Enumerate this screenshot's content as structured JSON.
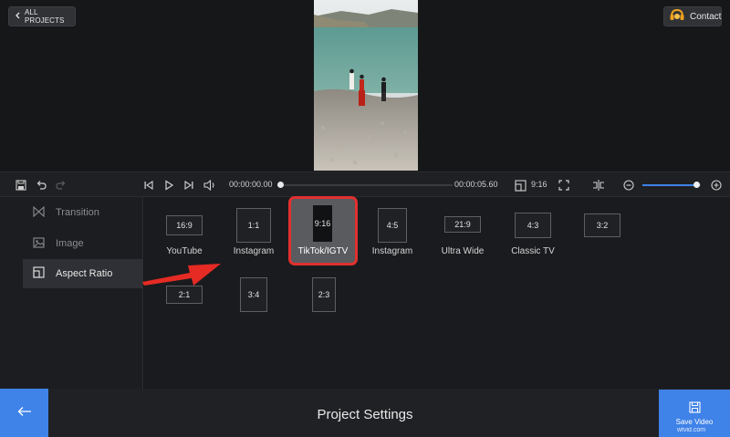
{
  "header": {
    "all_projects_label": "ALL PROJECTS",
    "contact_label": "Contact"
  },
  "toolbar": {
    "time_current": "00:00:00.00",
    "time_total": "00:00:05.60",
    "ratio_label": "9:16",
    "progress": 0.0,
    "zoom": 0.92
  },
  "sidebar": {
    "items": [
      {
        "label": "Transition",
        "icon": "transition-icon"
      },
      {
        "label": "Image",
        "icon": "image-icon"
      },
      {
        "label": "Aspect Ratio",
        "icon": "aspect-ratio-icon",
        "active": true
      }
    ]
  },
  "aspect_ratios": [
    {
      "ratio": "16:9",
      "name": "YouTube"
    },
    {
      "ratio": "1:1",
      "name": "Instagram"
    },
    {
      "ratio": "9:16",
      "name": "TikTok/IGTV",
      "selected": true
    },
    {
      "ratio": "4:5",
      "name": "Instagram"
    },
    {
      "ratio": "21:9",
      "name": "Ultra Wide"
    },
    {
      "ratio": "4:3",
      "name": "Classic TV"
    },
    {
      "ratio": "3:2",
      "name": ""
    },
    {
      "ratio": "2:1",
      "name": ""
    },
    {
      "ratio": "3:4",
      "name": ""
    },
    {
      "ratio": "2:3",
      "name": ""
    }
  ],
  "footer": {
    "title": "Project Settings",
    "save_label": "Save Video",
    "watermark": "wtvid.com"
  },
  "colors": {
    "accent": "#3f82e8",
    "highlight": "#e2302f",
    "background": "#151618"
  }
}
